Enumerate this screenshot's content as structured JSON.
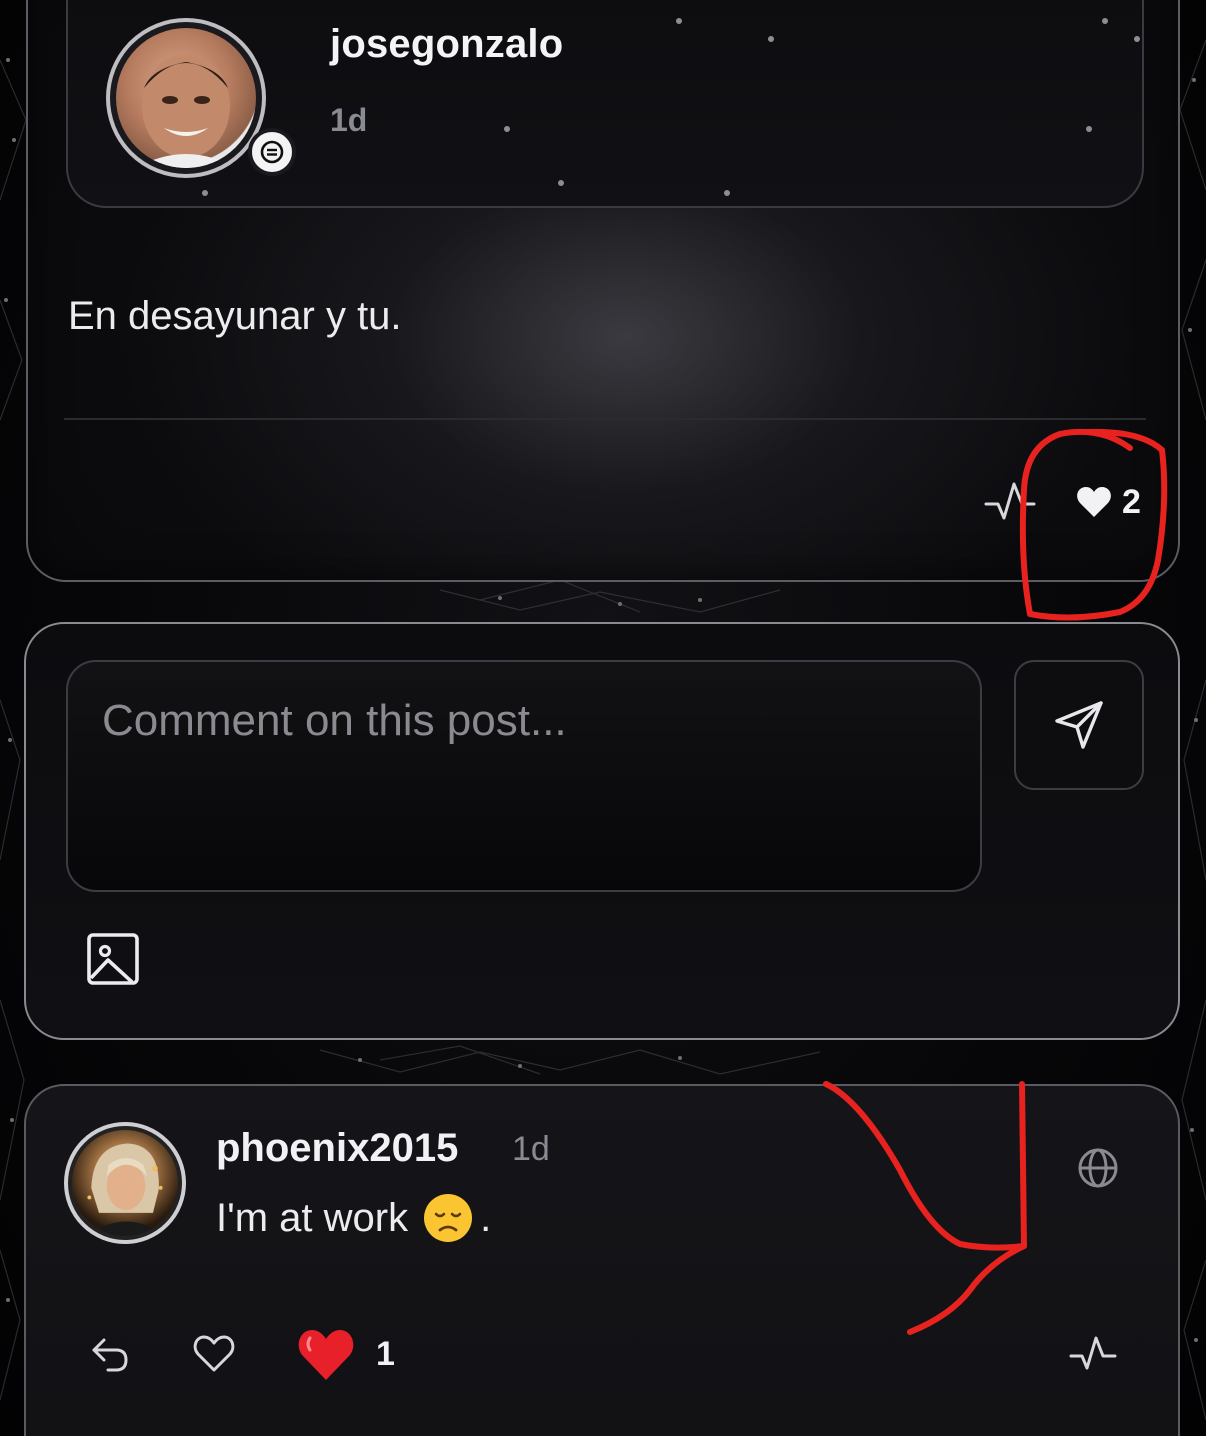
{
  "post": {
    "author": "josegonzalo",
    "time": "1d",
    "text": "En desayunar y tu.",
    "like_count": "2",
    "icons": {
      "badge": "verified-badge-icon",
      "activity": "activity-pulse-icon",
      "like": "heart-filled-icon"
    }
  },
  "composer": {
    "placeholder": "Comment on this post...",
    "icons": {
      "send": "send-icon",
      "image": "image-icon"
    }
  },
  "reply": {
    "author": "phoenix2015",
    "time": "1d",
    "text": "I'm at work",
    "text_suffix": ".",
    "reaction_count": "1",
    "icons": {
      "visibility": "globe-icon",
      "reply": "reply-arrow-icon",
      "like": "heart-outline-icon",
      "reaction": "red-heart-emoji",
      "activity": "activity-pulse-icon",
      "emoji": "disappointed-face-emoji"
    }
  },
  "colors": {
    "background": "#050507",
    "card_border": "#8a8a90",
    "text": "#f2f2f4",
    "muted": "#8a8a92",
    "annotation": "#e8231f",
    "reaction_heart": "#e8202a"
  }
}
